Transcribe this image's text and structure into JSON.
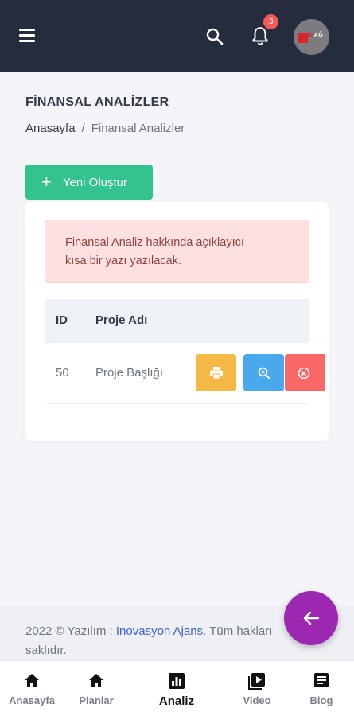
{
  "header": {
    "notification_count": "3",
    "avatar_text_a": "İM",
    "avatar_text_b": "AĞ"
  },
  "page": {
    "title": "FİNANSAL ANALİZLER",
    "breadcrumb": {
      "home": "Anasayfa",
      "separator": "/",
      "current": "Finansal Analizler"
    }
  },
  "actions": {
    "new_label": "Yeni Oluştur"
  },
  "alert": {
    "line1": "Finansal Analiz hakkında açıklayıcı",
    "line2": "kısa bir yazı yazılacak."
  },
  "table": {
    "columns": [
      "ID",
      "Proje Adı"
    ],
    "rows": [
      {
        "id": "50",
        "name": "Proje Başlığı"
      }
    ]
  },
  "footer": {
    "prefix": "2022 © Yazılım : ",
    "link": "İnovasyon Ajans",
    "suffix": ". Tüm hakları",
    "line2": "saklıdır."
  },
  "bottom_nav": [
    {
      "label": "Anasayfa",
      "icon": "home-icon"
    },
    {
      "label": "Planlar",
      "icon": "home-icon"
    },
    {
      "label": "Analiz",
      "icon": "chart-icon"
    },
    {
      "label": "Video",
      "icon": "video-icon"
    },
    {
      "label": "Blog",
      "icon": "document-icon"
    }
  ],
  "colors": {
    "topbar": "#252c3d",
    "success": "#34c38f",
    "warning": "#f4b845",
    "info": "#4aa8ec",
    "danger": "#fa6767",
    "fab": "#9c27b0",
    "link": "#3e60d5"
  }
}
